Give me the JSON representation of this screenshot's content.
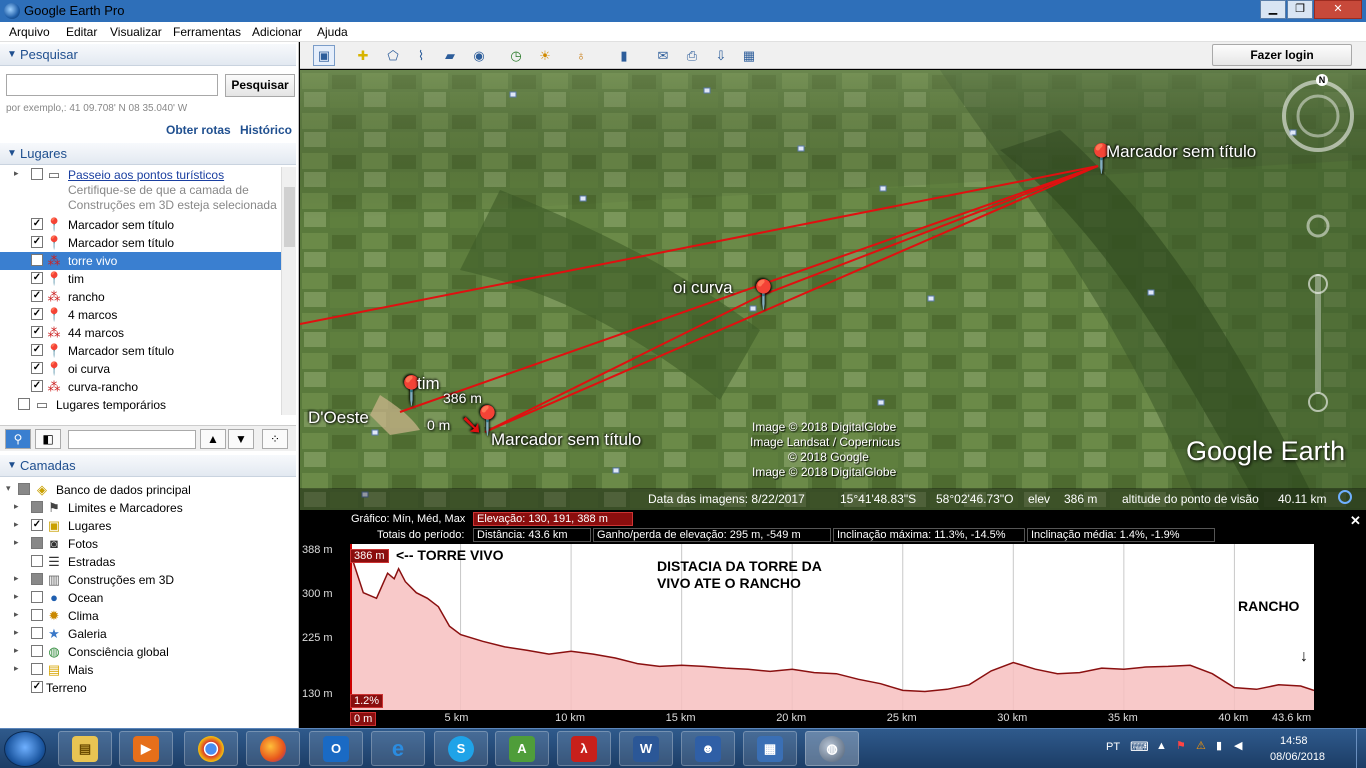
{
  "window": {
    "title": "Google Earth Pro",
    "min": "▁",
    "max": "❐",
    "close": "✕"
  },
  "menu": [
    "Arquivo",
    "Editar",
    "Visualizar",
    "Ferramentas",
    "Adicionar",
    "Ajuda"
  ],
  "toolbar": {
    "login_label": "Fazer login"
  },
  "search": {
    "section_label": "Pesquisar",
    "button_label": "Pesquisar",
    "input_value": "",
    "hint": "por exemplo,: 41 09.708' N 08 35.040' W",
    "route_link": "Obter rotas",
    "history_link": "Histórico"
  },
  "places": {
    "section_label": "Lugares",
    "items": [
      {
        "label": "Passeio aos pontos turísticos",
        "icon": "folder-icon",
        "checked": false,
        "link": true
      },
      {
        "label": "Certifique-se de que a camada de",
        "note": true
      },
      {
        "label": "Construções em 3D esteja selecionada",
        "note": true
      },
      {
        "label": "Marcador sem título",
        "icon": "yellow-pin-icon",
        "checked": true
      },
      {
        "label": "Marcador sem título",
        "icon": "yellow-pin-icon",
        "checked": true
      },
      {
        "label": "torre vivo",
        "icon": "path-icon",
        "checked": true,
        "selected": true
      },
      {
        "label": "tim",
        "icon": "yellow-pin-icon",
        "checked": true
      },
      {
        "label": "rancho",
        "icon": "path-icon",
        "checked": true
      },
      {
        "label": "4 marcos",
        "icon": "yellow-pin-icon",
        "checked": true
      },
      {
        "label": "44 marcos",
        "icon": "path-icon",
        "checked": true
      },
      {
        "label": "Marcador sem título",
        "icon": "yellow-pin-icon",
        "checked": true
      },
      {
        "label": "oi curva",
        "icon": "yellow-pin-icon",
        "checked": true
      },
      {
        "label": "curva-rancho",
        "icon": "path-icon",
        "checked": true
      },
      {
        "label": "Lugares temporários",
        "icon": "folder-icon",
        "checked": false
      }
    ]
  },
  "layers": {
    "section_label": "Camadas",
    "items": [
      {
        "label": "Banco de dados principal",
        "icon": "database-icon"
      },
      {
        "label": "Limites e Marcadores",
        "icon": "flag-icon"
      },
      {
        "label": "Lugares",
        "icon": "places-icon"
      },
      {
        "label": "Fotos",
        "icon": "camera-icon"
      },
      {
        "label": "Estradas",
        "icon": "road-icon"
      },
      {
        "label": "Construções em 3D",
        "icon": "building-icon"
      },
      {
        "label": "Ocean",
        "icon": "ocean-icon"
      },
      {
        "label": "Clima",
        "icon": "weather-icon"
      },
      {
        "label": "Galeria",
        "icon": "star-icon"
      },
      {
        "label": "Consciência global",
        "icon": "globe-icon"
      },
      {
        "label": "Mais",
        "icon": "more-icon"
      },
      {
        "label": "Terreno",
        "icon": ""
      }
    ]
  },
  "map": {
    "placemarks": [
      "Marcador sem título",
      "oi curva",
      "tim",
      "D'Oeste",
      "386 m",
      "0 m",
      "Marcador sem título"
    ],
    "credits": [
      "Image © 2018 DigitalGlobe",
      "Image Landsat / Copernicus",
      "© 2018 Google",
      "Image © 2018 DigitalGlobe"
    ],
    "logo": "Google Earth",
    "compass_n": "N",
    "status": {
      "date": "Data das imagens: 8/22/2017",
      "lat": "15°41'48.83\"S",
      "lon": "58°02'46.73\"O",
      "elev_label": "elev",
      "elev": "386 m",
      "alt_label": "altitude do ponto de visão",
      "alt": "40.11 km"
    }
  },
  "profile": {
    "graph_label": "Gráfico: Mín, Méd, Max",
    "elev_box": "Elevação: 130, 191, 388 m",
    "totals_label": "Totais do período:",
    "distance": "Distância: 43.6 km",
    "gain": "Ganho/perda de elevação: 295 m, -549 m",
    "max_slope": "Inclinação máxima: 11.3%, -14.5%",
    "avg_slope": "Inclinação média: 1.4%, -1.9%",
    "close": "✕",
    "cursor_elev": "386 m",
    "cursor_slope": "1.2%",
    "cursor_dist": "0 m",
    "ann_torre": "<-- TORRE VIVO",
    "ann_title_1": "DISTACIA DA TORRE DA",
    "ann_title_2": "VIVO ATE O RANCHO",
    "ann_rancho": "RANCHO",
    "ann_arrow": "↓",
    "y_ticks": [
      "388 m",
      "300 m",
      "225 m",
      "130 m"
    ],
    "x_ticks": [
      "5 km",
      "10 km",
      "15 km",
      "20 km",
      "25 km",
      "30 km",
      "35 km",
      "40 km",
      "43.6 km"
    ]
  },
  "chart_data": {
    "type": "area",
    "xlabel": "",
    "ylabel": "",
    "x_unit": "km",
    "y_unit": "m",
    "ylim": [
      130,
      388
    ],
    "xlim": [
      0,
      43.6
    ],
    "x": [
      0,
      0.6,
      1.2,
      1.7,
      2.0,
      2.2,
      2.5,
      3.0,
      3.5,
      4.0,
      4.5,
      5.0,
      6.0,
      7.0,
      8.0,
      9.0,
      10.0,
      11.0,
      12.0,
      13.0,
      14.0,
      15.0,
      16.0,
      17.0,
      18.0,
      19.0,
      20.0,
      21.0,
      22.0,
      23.0,
      24.0,
      25.0,
      26.0,
      27.0,
      28.0,
      29.0,
      30.0,
      31.0,
      32.0,
      33.0,
      34.0,
      35.0,
      36.0,
      37.0,
      38.0,
      39.0,
      40.0,
      41.0,
      42.0,
      43.0,
      43.6
    ],
    "series": [
      {
        "values": [
          388,
          315,
          305,
          350,
          340,
          358,
          335,
          315,
          305,
          290,
          255,
          240,
          228,
          218,
          212,
          205,
          210,
          205,
          198,
          188,
          183,
          185,
          183,
          180,
          178,
          174,
          178,
          172,
          170,
          160,
          152,
          140,
          138,
          142,
          150,
          175,
          190,
          178,
          170,
          172,
          180,
          178,
          182,
          183,
          185,
          170,
          145,
          142,
          150,
          148,
          140
        ]
      }
    ]
  }
}
